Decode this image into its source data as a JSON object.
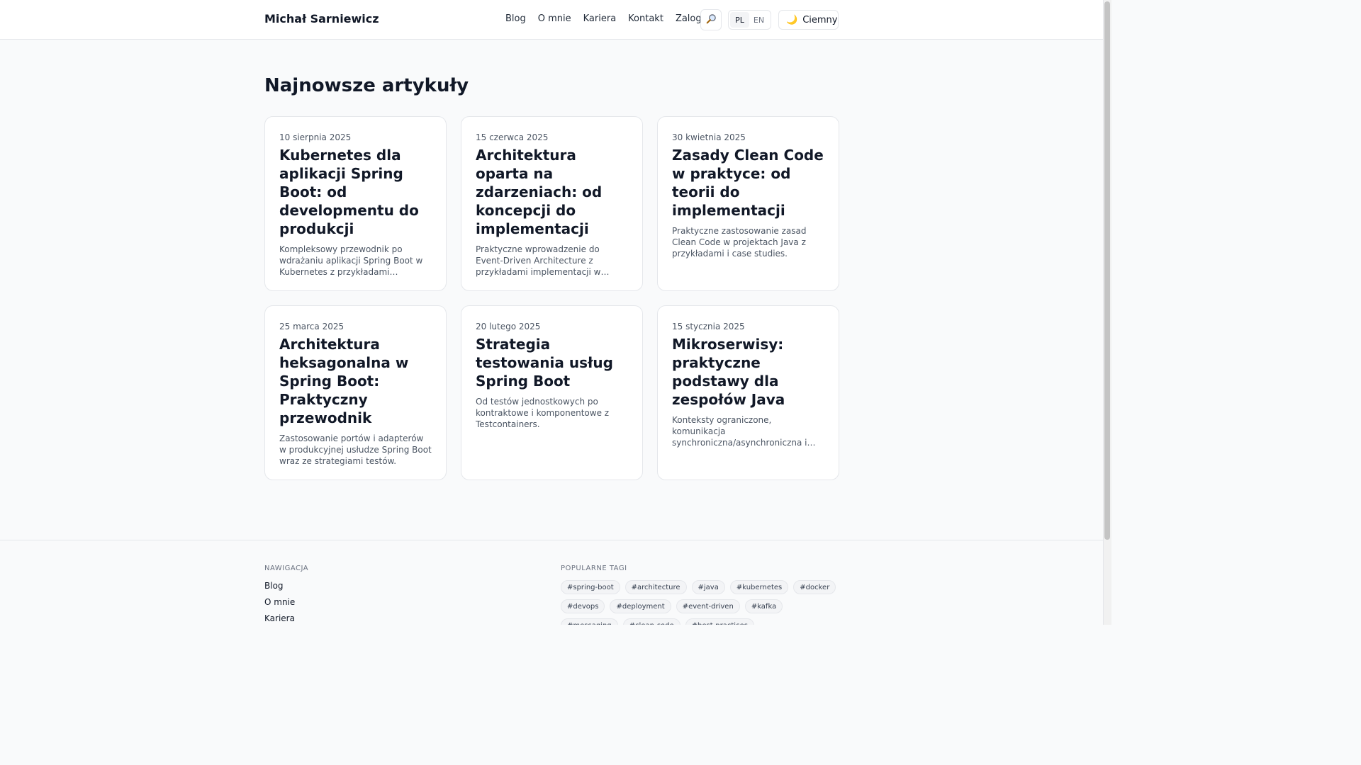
{
  "header": {
    "brand": "Michał Sarniewicz",
    "nav": [
      "Blog",
      "O mnie",
      "Kariera",
      "Kontakt",
      "Zaloguj"
    ],
    "search_icon": "magnifier-icon",
    "languages": [
      "PL",
      "EN"
    ],
    "active_language": "PL",
    "theme_label": "Ciemny",
    "theme_icon": "moon-icon"
  },
  "main": {
    "title": "Najnowsze artykuły",
    "articles": [
      {
        "date": "10 sierpnia 2025",
        "title": "Kubernetes dla aplikacji Spring Boot: od developmentu do produkcji",
        "excerpt": "Kompleksowy przewodnik po wdrażaniu aplikacji Spring Boot w Kubernetes z przykładami…"
      },
      {
        "date": "15 czerwca 2025",
        "title": "Architektura oparta na zdarzeniach: od koncepcji do implementacji",
        "excerpt": "Praktyczne wprowadzenie do Event-Driven Architecture z przykładami implementacji w Spring Boot i…"
      },
      {
        "date": "30 kwietnia 2025",
        "title": "Zasady Clean Code w praktyce: od teorii do implementacji",
        "excerpt": "Praktyczne zastosowanie zasad Clean Code w projektach Java z przykładami i case studies."
      },
      {
        "date": "25 marca 2025",
        "title": "Architektura heksagonalna w Spring Boot: Praktyczny przewodnik",
        "excerpt": "Zastosowanie portów i adapterów w produkcyjnej usłudze Spring Boot wraz ze strategiami testów."
      },
      {
        "date": "20 lutego 2025",
        "title": "Strategia testowania usług Spring Boot",
        "excerpt": "Od testów jednostkowych po kontraktowe i komponentowe z Testcontainers."
      },
      {
        "date": "15 stycznia 2025",
        "title": "Mikroserwisy: praktyczne podstawy dla zespołów Java",
        "excerpt": "Konteksty ograniczone, komunikacja synchroniczna/asynchroniczna i operacje."
      }
    ]
  },
  "footer": {
    "nav_heading": "NAWIGACJA",
    "nav_links": [
      "Blog",
      "O mnie",
      "Kariera"
    ],
    "tags_heading": "POPULARNE TAGI",
    "tags": [
      "#spring-boot",
      "#architecture",
      "#java",
      "#kubernetes",
      "#docker",
      "#devops",
      "#deployment",
      "#event-driven",
      "#kafka",
      "#messaging",
      "#clean-code",
      "#best-practices"
    ]
  }
}
